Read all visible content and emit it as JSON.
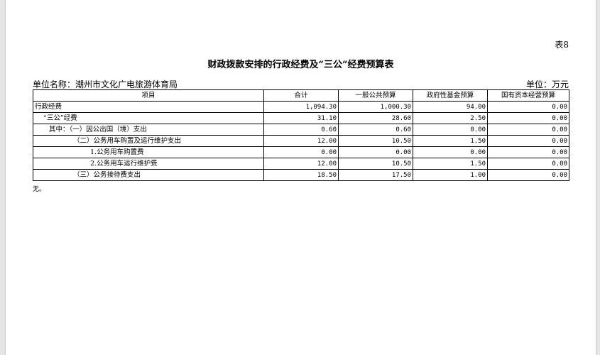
{
  "table_no": "表8",
  "title": "财政拨款安排的行政经费及“三公”经费预算表",
  "unit_name": "单位名称：潮州市文化广电旅游体育局",
  "unit_currency": "单位：万元",
  "headers": [
    "项目",
    "合计",
    "一般公共预算",
    "政府性基金预算",
    "国有资本经营预算"
  ],
  "rows": [
    {
      "label": "行政经费",
      "total": "1,094.30",
      "general": "1,000.30",
      "fund": "94.00",
      "capital": "0.00"
    },
    {
      "label": "“三公”经费",
      "total": "31.10",
      "general": "28.60",
      "fund": "2.50",
      "capital": "0.00"
    },
    {
      "label": "其中：（一）因公出国（境）支出",
      "total": "0.60",
      "general": "0.60",
      "fund": "0.00",
      "capital": "0.00"
    },
    {
      "label": "（二）公务用车购置及运行维护支出",
      "total": "12.00",
      "general": "10.50",
      "fund": "1.50",
      "capital": "0.00"
    },
    {
      "label": "1.公务用车购置费",
      "total": "0.00",
      "general": "0.00",
      "fund": "0.00",
      "capital": "0.00"
    },
    {
      "label": "2.公务用车运行维护费",
      "total": "12.00",
      "general": "10.50",
      "fund": "1.50",
      "capital": "0.00"
    },
    {
      "label": "（三）公务接待费支出",
      "total": "18.50",
      "general": "17.50",
      "fund": "1.00",
      "capital": "0.00"
    }
  ],
  "note": "无。"
}
